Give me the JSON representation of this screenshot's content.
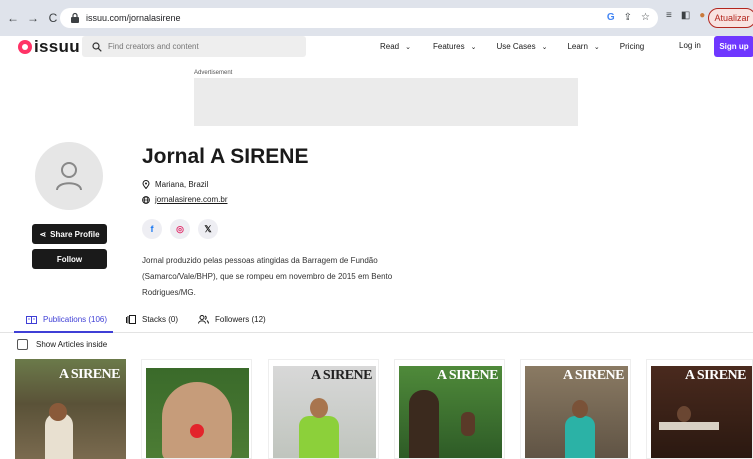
{
  "browser": {
    "url": "issuu.com/jornalasirene",
    "update_label": "Atualizar"
  },
  "header": {
    "logo_text": "issuu",
    "search_placeholder": "Find creators and content",
    "nav": [
      {
        "label": "Read"
      },
      {
        "label": "Features"
      },
      {
        "label": "Use Cases"
      },
      {
        "label": "Learn"
      },
      {
        "label": "Pricing"
      }
    ],
    "login_label": "Log in",
    "signup_label": "Sign up"
  },
  "ad": {
    "label": "Advertisement"
  },
  "profile": {
    "name": "Jornal A SIRENE",
    "location": "Mariana, Brazil",
    "website": "jornalasirene.com.br",
    "share_label": "Share Profile",
    "follow_label": "Follow",
    "bio": "Jornal produzido pelas pessoas atingidas da Barragem de Fundão (Samarco/Vale/BHP), que se rompeu em novembro de 2015 em Bento Rodrigues/MG.",
    "socials": [
      {
        "icon": "facebook-icon",
        "color": "#1877f2"
      },
      {
        "icon": "instagram-icon",
        "color": "#e1306c"
      },
      {
        "icon": "x-icon",
        "color": "#1a1a1a"
      }
    ]
  },
  "tabs": [
    {
      "label": "Publications (106)",
      "icon": "book-icon"
    },
    {
      "label": "Stacks (0)",
      "icon": "stack-icon"
    },
    {
      "label": "Followers (12)",
      "icon": "users-icon"
    }
  ],
  "filter": {
    "label": "Show Articles inside"
  },
  "covers": [
    {
      "title": "A SIRENE"
    },
    {
      "title": ""
    },
    {
      "title": "A SIRENE"
    },
    {
      "title": "A SIRENE"
    },
    {
      "title": "A SIRENE"
    },
    {
      "title": "A SIRENE"
    }
  ],
  "colors": {
    "brand": "#f36",
    "accent": "#6f37ff",
    "tab_active": "#3f3fd6"
  }
}
